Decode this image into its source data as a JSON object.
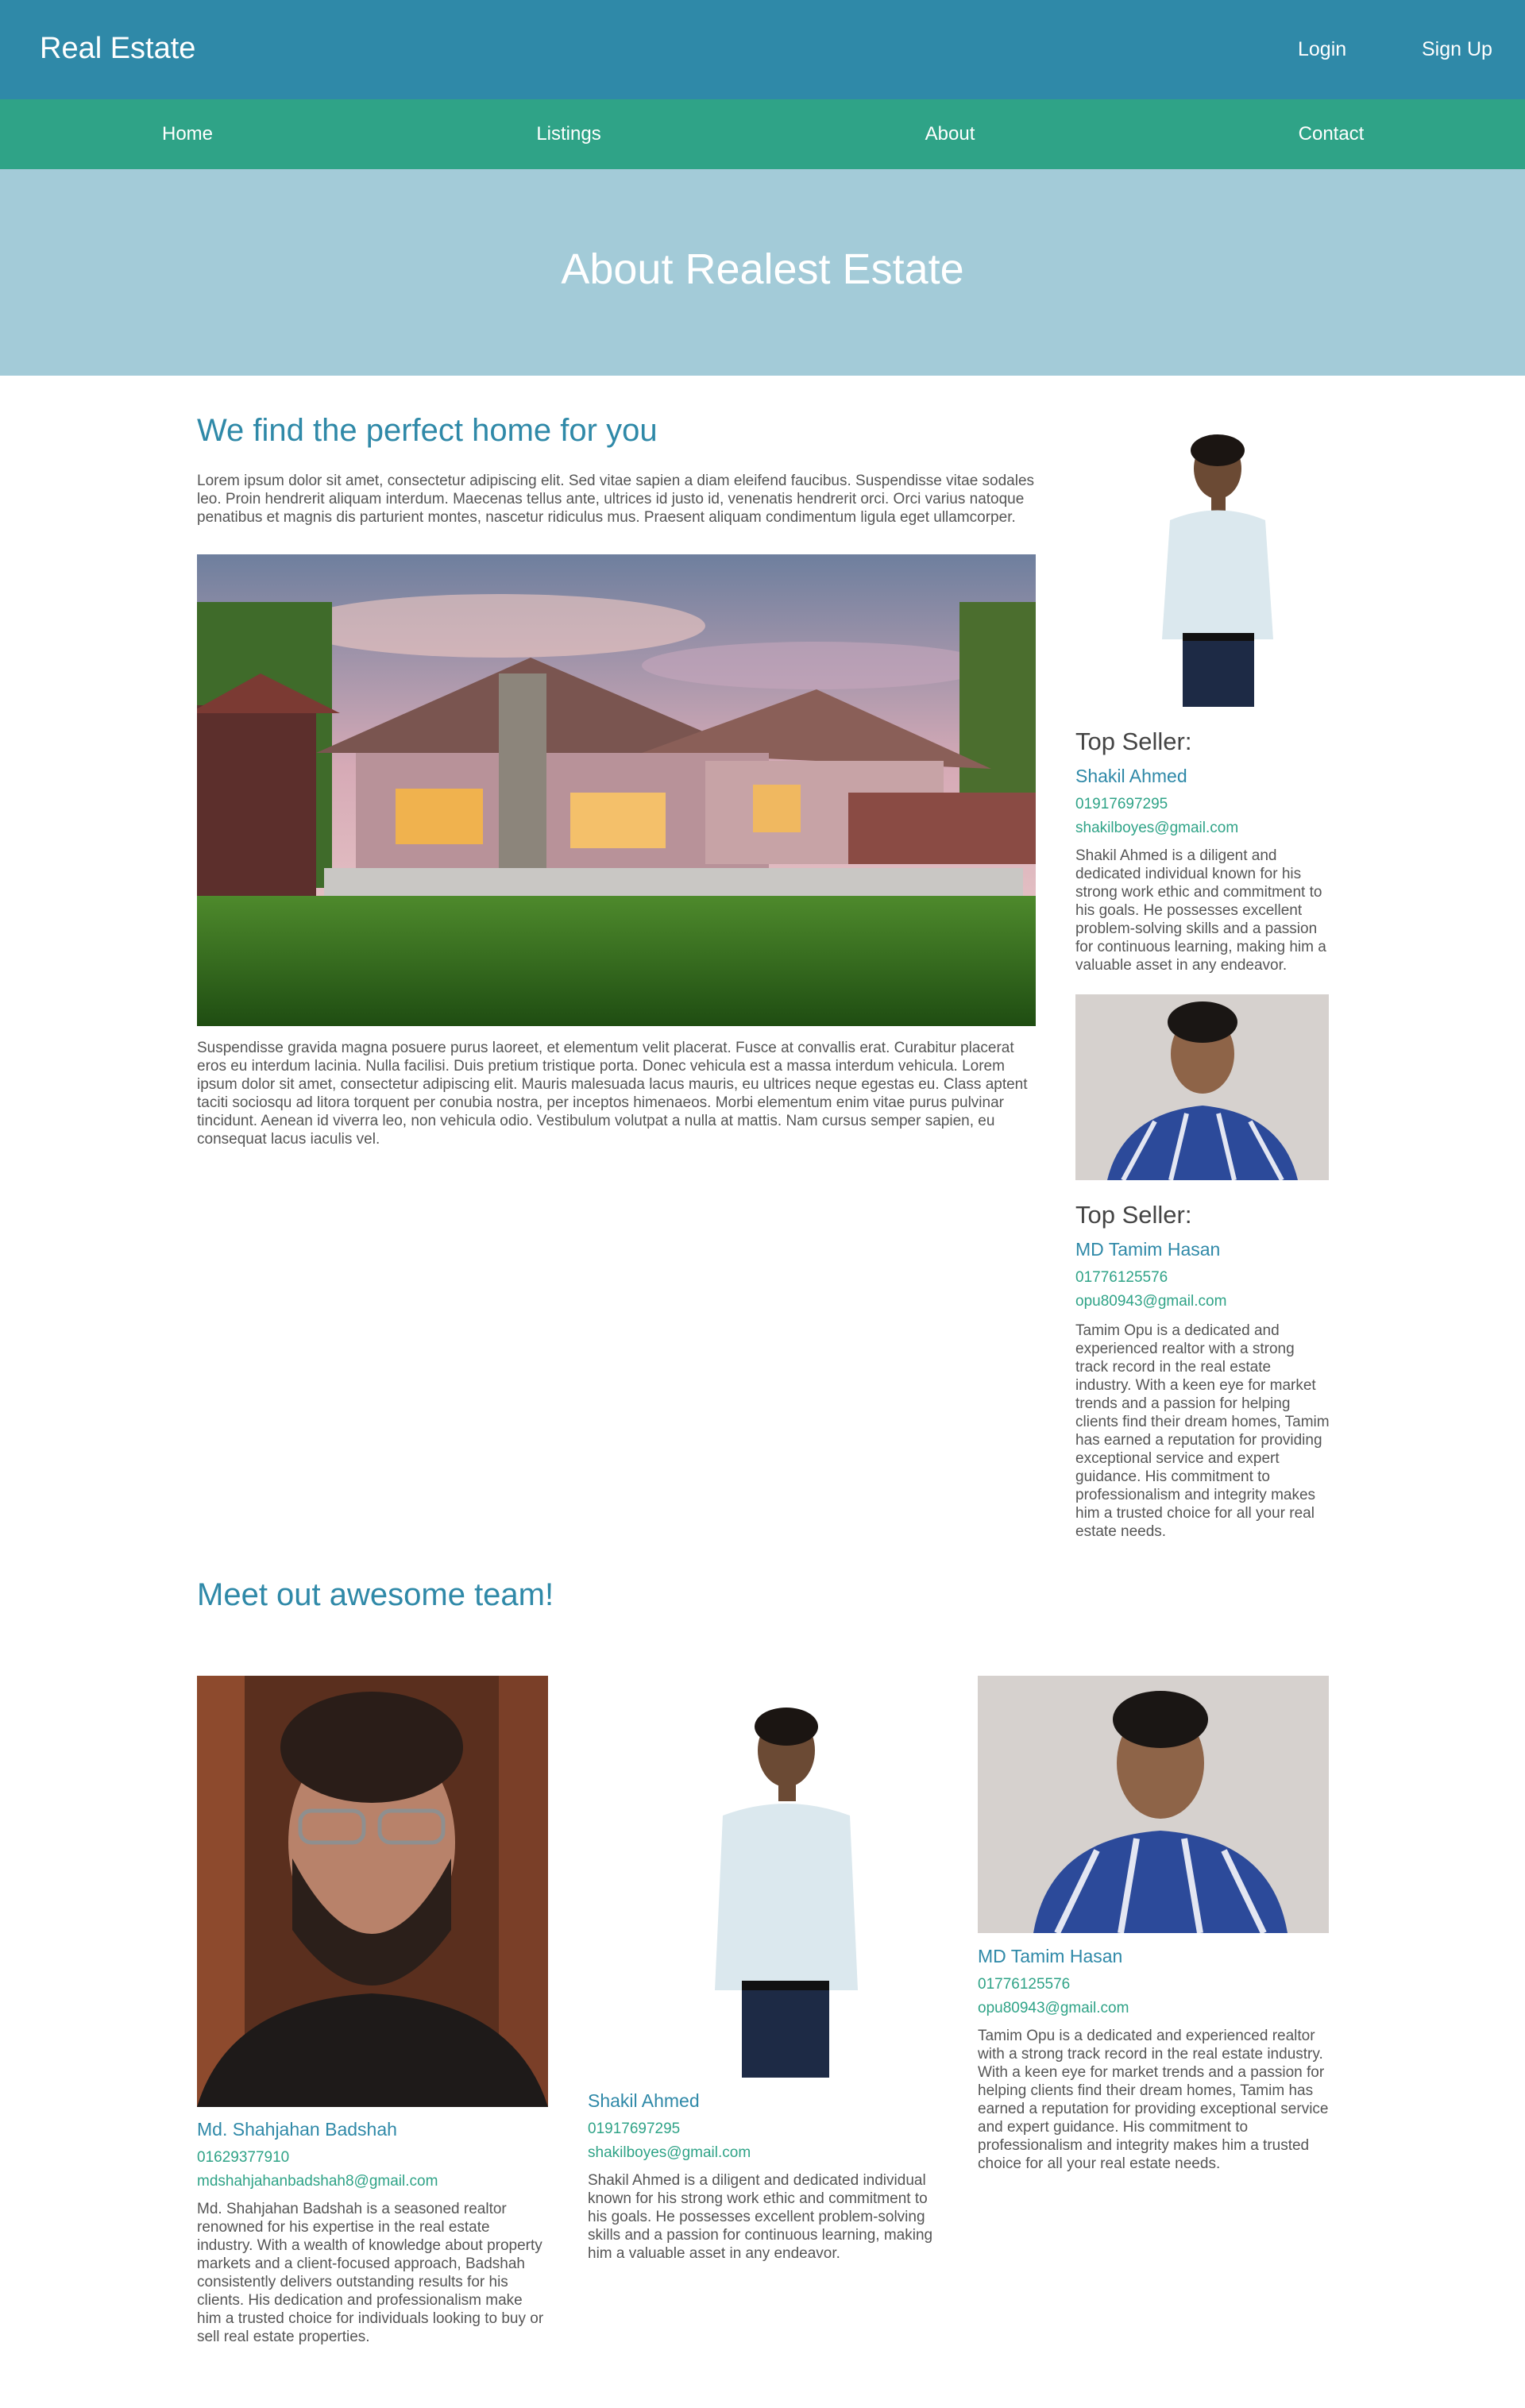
{
  "header": {
    "brand": "Real Estate",
    "login": "Login",
    "signup": "Sign Up"
  },
  "nav": {
    "items": [
      "Home",
      "Listings",
      "About",
      "Contact"
    ]
  },
  "hero": {
    "title": "About Realest Estate"
  },
  "main": {
    "heading": "We find the perfect home for you",
    "intro": "Lorem ipsum dolor sit amet, consectetur adipiscing elit. Sed vitae sapien a diam eleifend faucibus. Suspendisse vitae sodales leo. Proin hendrerit aliquam interdum. Maecenas tellus ante, ultrices id justo id, venenatis hendrerit orci. Orci varius natoque penatibus et magnis dis parturient montes, nascetur ridiculus mus. Praesent aliquam condimentum ligula eget ullamcorper.",
    "body": "Suspendisse gravida magna posuere purus laoreet, et elementum velit placerat. Fusce at convallis erat. Curabitur placerat eros eu interdum lacinia. Nulla facilisi. Duis pretium tristique porta. Donec vehicula est a massa interdum vehicula. Lorem ipsum dolor sit amet, consectetur adipiscing elit. Mauris malesuada lacus mauris, eu ultrices neque egestas eu. Class aptent taciti sociosqu ad litora torquent per conubia nostra, per inceptos himenaeos. Morbi elementum enim vitae purus pulvinar tincidunt. Aenean id viverra leo, non vehicula odio. Vestibulum volutpat a nulla at mattis. Nam cursus semper sapien, eu consequat lacus iaculis vel."
  },
  "sellers": [
    {
      "heading": "Top Seller:",
      "name": "Shakil Ahmed",
      "phone": "01917697295",
      "email": "shakilboyes@gmail.com",
      "desc": "Shakil Ahmed is a diligent and dedicated individual known for his strong work ethic and commitment to his goals. He possesses excellent problem-solving skills and a passion for continuous learning, making him a valuable asset in any endeavor."
    },
    {
      "heading": "Top Seller:",
      "name": "MD Tamim Hasan",
      "phone": "01776125576",
      "email": "opu80943@gmail.com",
      "desc": "Tamim Opu is a dedicated and experienced realtor with a strong track record in the real estate industry. With a keen eye for market trends and a passion for helping clients find their dream homes, Tamim has earned a reputation for providing exceptional service and expert guidance. His commitment to professionalism and integrity makes him a trusted choice for all your real estate needs."
    }
  ],
  "team": {
    "heading": "Meet out awesome team!",
    "members": [
      {
        "name": "Md. Shahjahan Badshah",
        "phone": "01629377910",
        "email": "mdshahjahanbadshah8@gmail.com",
        "desc": "Md. Shahjahan Badshah is a seasoned realtor renowned for his expertise in the real estate industry. With a wealth of knowledge about property markets and a client-focused approach, Badshah consistently delivers outstanding results for his clients. His dedication and professionalism make him a trusted choice for individuals looking to buy or sell real estate properties."
      },
      {
        "name": "Shakil Ahmed",
        "phone": "01917697295",
        "email": "shakilboyes@gmail.com",
        "desc": "Shakil Ahmed is a diligent and dedicated individual known for his strong work ethic and commitment to his goals. He possesses excellent problem-solving skills and a passion for continuous learning, making him a valuable asset in any endeavor."
      },
      {
        "name": "MD Tamim Hasan",
        "phone": "01776125576",
        "email": "opu80943@gmail.com",
        "desc": "Tamim Opu is a dedicated and experienced realtor with a strong track record in the real estate industry. With a keen eye for market trends and a passion for helping clients find their dream homes, Tamim has earned a reputation for providing exceptional service and expert guidance. His commitment to professionalism and integrity makes him a trusted choice for all your real estate needs."
      }
    ]
  }
}
